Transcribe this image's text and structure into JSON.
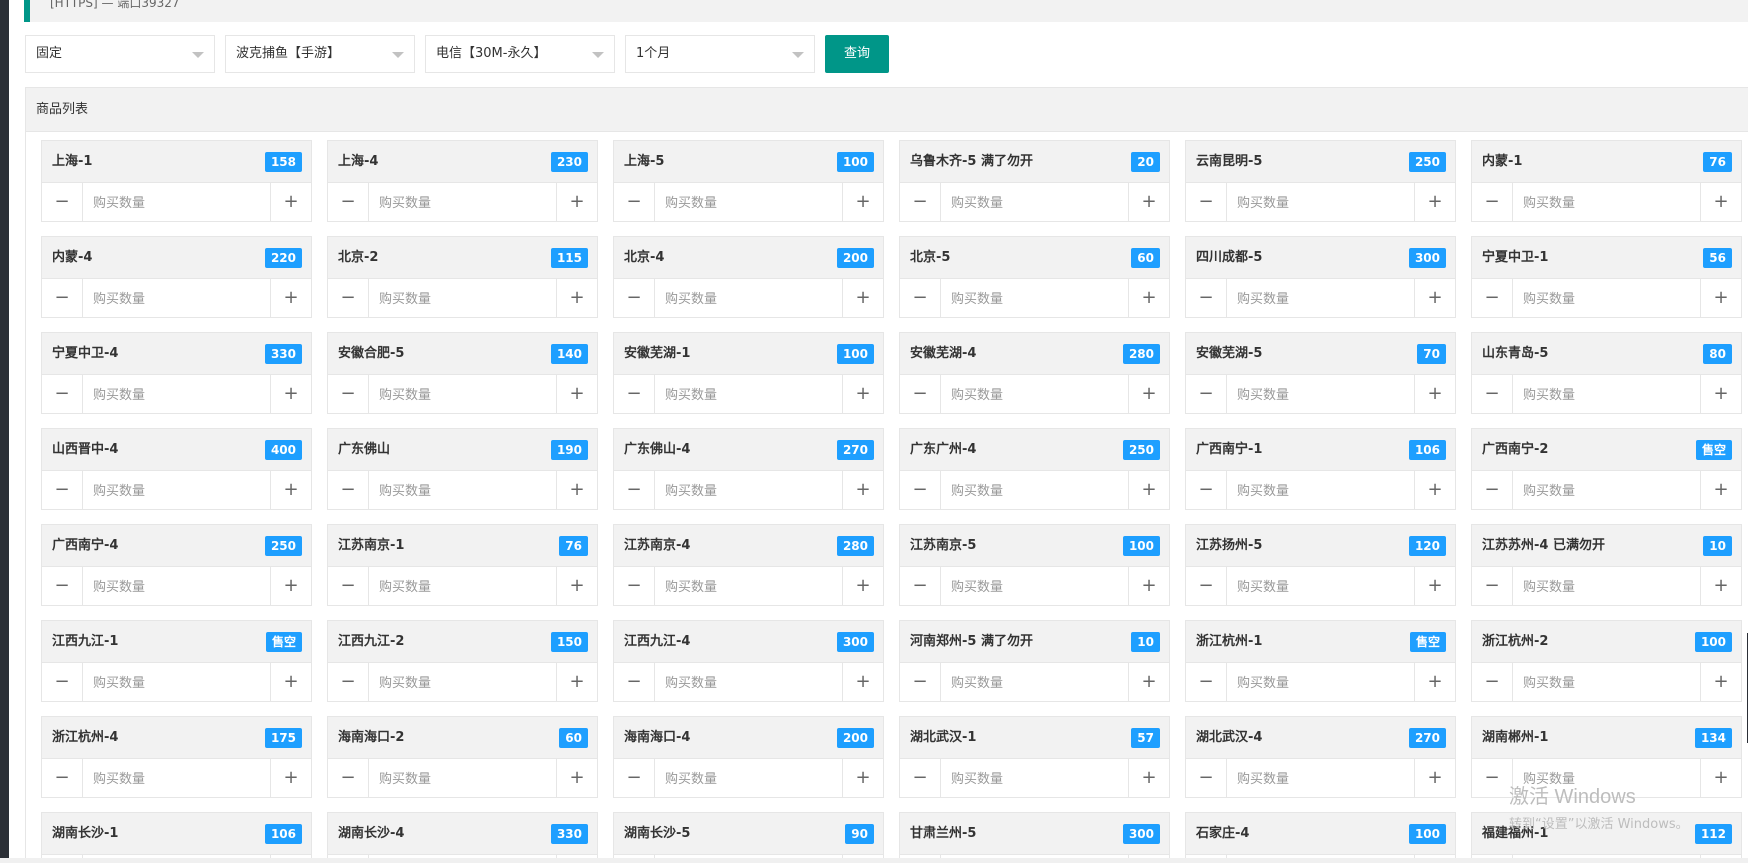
{
  "top_bar": {
    "text": "[HTTPS] — 端口39327"
  },
  "filters": [
    {
      "name": "type-select",
      "value": "固定"
    },
    {
      "name": "game-select",
      "value": "波克捕鱼【手游】"
    },
    {
      "name": "line-select",
      "value": "电信【30M-永久】"
    },
    {
      "name": "duration-select",
      "value": "1个月"
    }
  ],
  "query_button": "查询",
  "panel_title": "商品列表",
  "qty_placeholder": "购买数量",
  "minus_symbol": "−",
  "plus_symbol": "+",
  "items": [
    {
      "name": "上海-1",
      "stock": "158"
    },
    {
      "name": "上海-4",
      "stock": "230"
    },
    {
      "name": "上海-5",
      "stock": "100"
    },
    {
      "name": "乌鲁木齐-5 满了勿开",
      "stock": "20"
    },
    {
      "name": "云南昆明-5",
      "stock": "250"
    },
    {
      "name": "内蒙-1",
      "stock": "76"
    },
    {
      "name": "内蒙-4",
      "stock": "220"
    },
    {
      "name": "北京-2",
      "stock": "115"
    },
    {
      "name": "北京-4",
      "stock": "200"
    },
    {
      "name": "北京-5",
      "stock": "60"
    },
    {
      "name": "四川成都-5",
      "stock": "300"
    },
    {
      "name": "宁夏中卫-1",
      "stock": "56"
    },
    {
      "name": "宁夏中卫-4",
      "stock": "330"
    },
    {
      "name": "安徽合肥-5",
      "stock": "140"
    },
    {
      "name": "安徽芜湖-1",
      "stock": "100"
    },
    {
      "name": "安徽芜湖-4",
      "stock": "280"
    },
    {
      "name": "安徽芜湖-5",
      "stock": "70"
    },
    {
      "name": "山东青岛-5",
      "stock": "80"
    },
    {
      "name": "山西晋中-4",
      "stock": "400"
    },
    {
      "name": "广东佛山",
      "stock": "190"
    },
    {
      "name": "广东佛山-4",
      "stock": "270"
    },
    {
      "name": "广东广州-4",
      "stock": "250"
    },
    {
      "name": "广西南宁-1",
      "stock": "106"
    },
    {
      "name": "广西南宁-2",
      "stock": "售空"
    },
    {
      "name": "广西南宁-4",
      "stock": "250"
    },
    {
      "name": "江苏南京-1",
      "stock": "76"
    },
    {
      "name": "江苏南京-4",
      "stock": "280"
    },
    {
      "name": "江苏南京-5",
      "stock": "100"
    },
    {
      "name": "江苏扬州-5",
      "stock": "120"
    },
    {
      "name": "江苏苏州-4 已满勿开",
      "stock": "10"
    },
    {
      "name": "江西九江-1",
      "stock": "售空"
    },
    {
      "name": "江西九江-2",
      "stock": "150"
    },
    {
      "name": "江西九江-4",
      "stock": "300"
    },
    {
      "name": "河南郑州-5 满了勿开",
      "stock": "10"
    },
    {
      "name": "浙江杭州-1",
      "stock": "售空"
    },
    {
      "name": "浙江杭州-2",
      "stock": "100"
    },
    {
      "name": "浙江杭州-4",
      "stock": "175"
    },
    {
      "name": "海南海口-2",
      "stock": "60"
    },
    {
      "name": "海南海口-4",
      "stock": "200"
    },
    {
      "name": "湖北武汉-1",
      "stock": "57"
    },
    {
      "name": "湖北武汉-4",
      "stock": "270"
    },
    {
      "name": "湖南郴州-1",
      "stock": "134"
    },
    {
      "name": "湖南长沙-1",
      "stock": "106"
    },
    {
      "name": "湖南长沙-4",
      "stock": "330"
    },
    {
      "name": "湖南长沙-5",
      "stock": "90"
    },
    {
      "name": "甘肃兰州-5",
      "stock": "300"
    },
    {
      "name": "石家庄-4",
      "stock": "100"
    },
    {
      "name": "福建福州-1",
      "stock": "112"
    }
  ],
  "watermark": {
    "title": "激活 Windows",
    "subtitle": "转到“设置”以激活 Windows。"
  },
  "colors": {
    "accent": "#009688",
    "badge": "#1e9fff"
  }
}
